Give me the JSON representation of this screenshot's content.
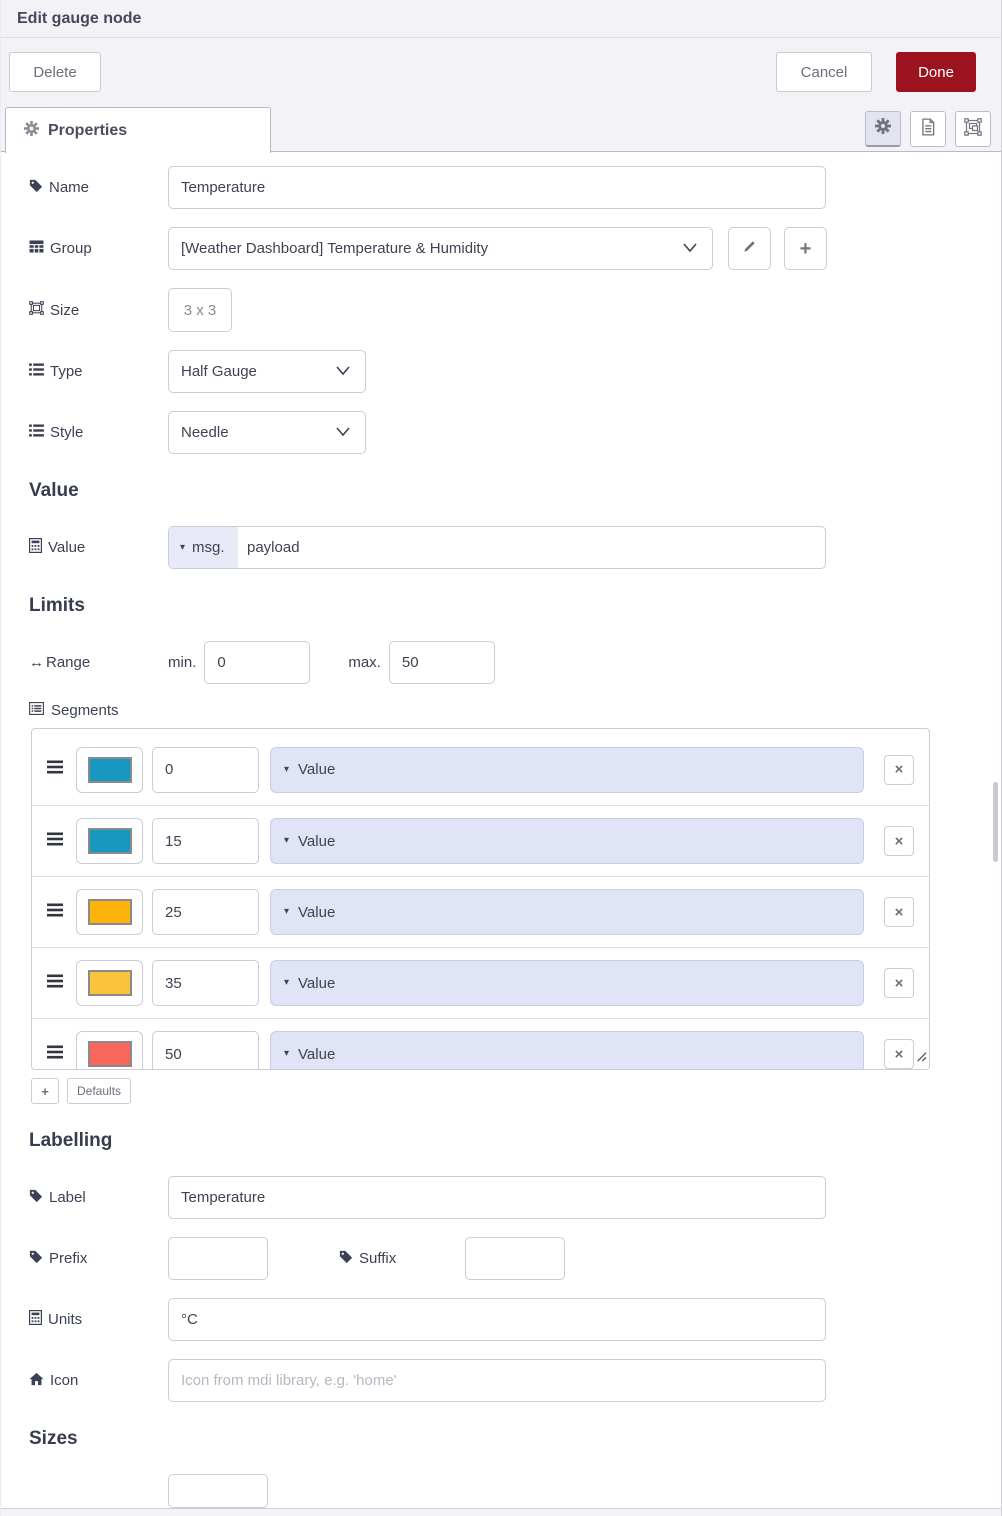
{
  "header": {
    "title": "Edit gauge node"
  },
  "actions": {
    "delete": "Delete",
    "cancel": "Cancel",
    "done": "Done"
  },
  "tabs": {
    "properties": "Properties"
  },
  "form": {
    "name": {
      "label": "Name",
      "value": "Temperature"
    },
    "group": {
      "label": "Group",
      "value": "[Weather Dashboard] Temperature & Humidity"
    },
    "size": {
      "label": "Size",
      "value": "3 x 3"
    },
    "type": {
      "label": "Type",
      "value": "Half Gauge"
    },
    "style": {
      "label": "Style",
      "value": "Needle"
    }
  },
  "sections": {
    "value": "Value",
    "limits": "Limits",
    "labelling": "Labelling",
    "sizes": "Sizes"
  },
  "value_row": {
    "label": "Value",
    "prefix": "msg.",
    "value": "payload"
  },
  "range": {
    "label": "Range",
    "min_label": "min.",
    "min_value": "0",
    "max_label": "max.",
    "max_value": "50"
  },
  "segments": {
    "label": "Segments",
    "add_label": "+",
    "defaults_label": "Defaults",
    "remove_label": "×",
    "rows": [
      {
        "color": "#1898c1",
        "dotted": false,
        "value": "0",
        "type_label": "Value"
      },
      {
        "color": "#1898c1",
        "dotted": false,
        "value": "15",
        "type_label": "Value"
      },
      {
        "color": "#fdb30b",
        "dotted": false,
        "value": "25",
        "type_label": "Value"
      },
      {
        "color": "#fdc23c",
        "dotted": true,
        "value": "35",
        "type_label": "Value"
      },
      {
        "color": "#f9665c",
        "dotted": false,
        "value": "50",
        "type_label": "Value"
      }
    ]
  },
  "labelling": {
    "label_row": {
      "label": "Label",
      "value": "Temperature"
    },
    "prefix_row": {
      "label": "Prefix",
      "value": ""
    },
    "suffix_row": {
      "label": "Suffix",
      "value": ""
    },
    "units_row": {
      "label": "Units",
      "value": "°C"
    },
    "icon_row": {
      "label": "Icon",
      "placeholder": "Icon from mdi library, e.g. 'home'"
    }
  },
  "colors": {
    "done_button": "#9c1320",
    "typed_prefix_bg": "#e9eaf8",
    "segment_dropdown_bg": "#e1e4f6"
  }
}
